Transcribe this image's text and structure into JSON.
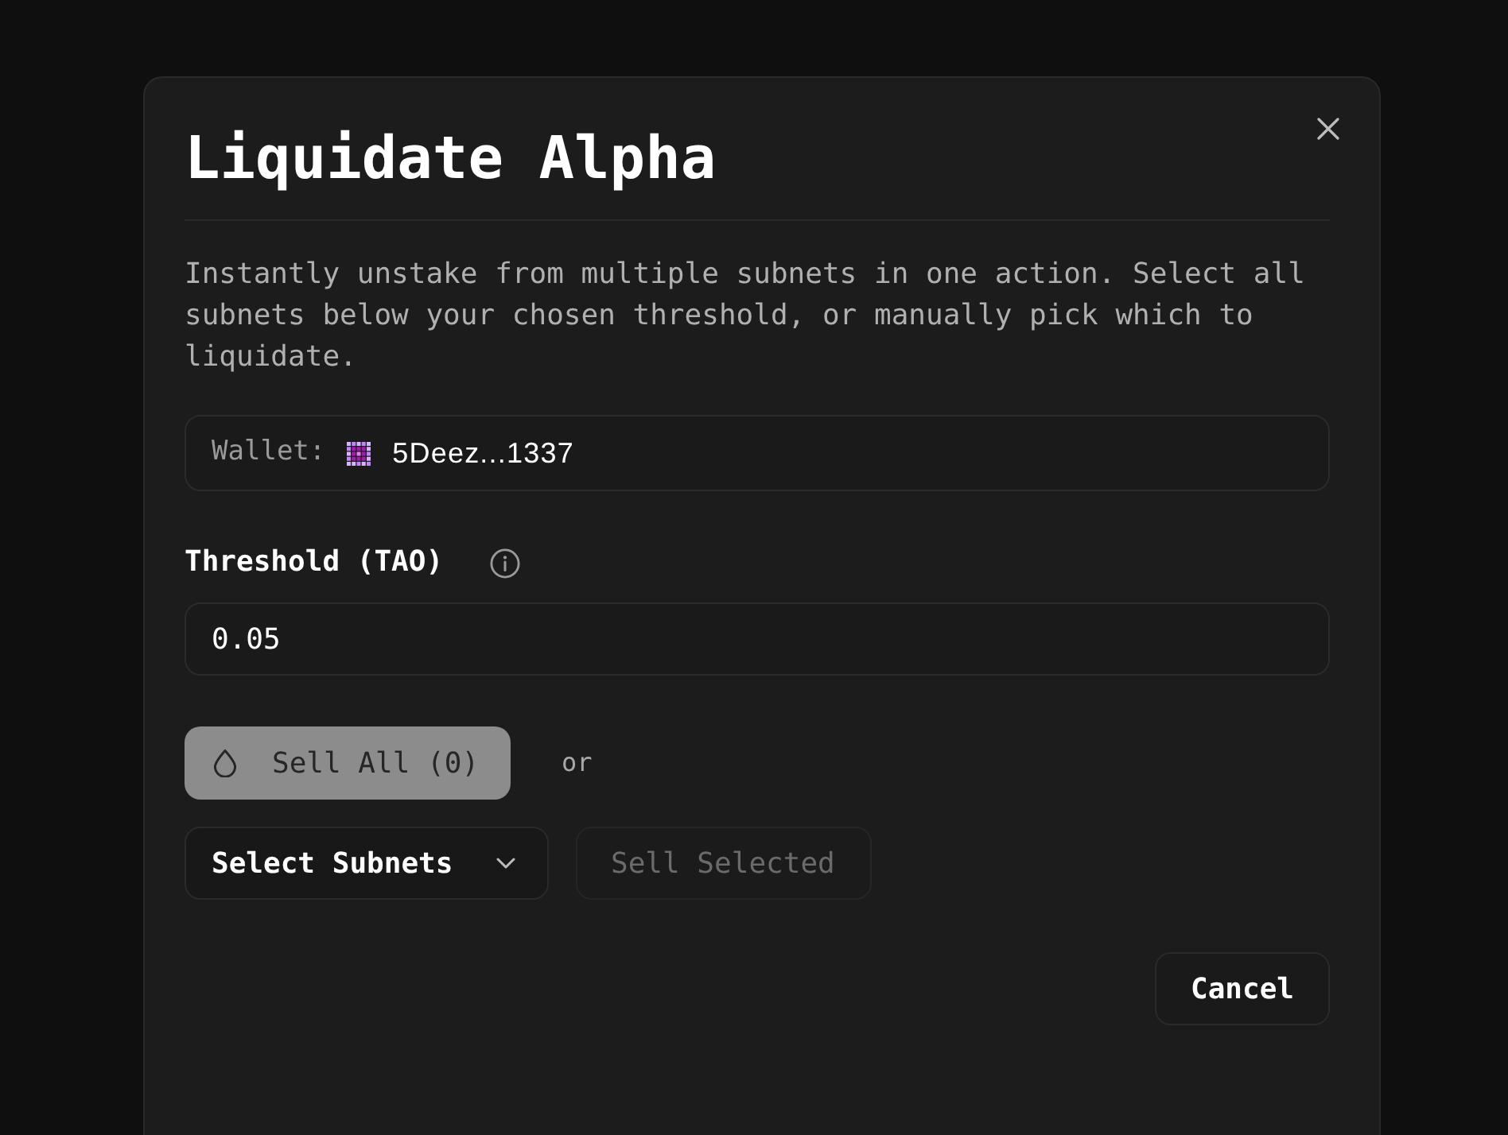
{
  "dialog": {
    "title": "Liquidate Alpha",
    "description": "Instantly unstake from multiple subnets in one action. Select all subnets below your chosen threshold, or manually pick which to liquidate."
  },
  "wallet": {
    "label": "Wallet:",
    "address": "5Deez...1337"
  },
  "threshold": {
    "label": "Threshold (TAO)",
    "value": "0.05"
  },
  "sell_all": {
    "label": "Sell All (0)",
    "disabled": true
  },
  "separator_text": "or",
  "subnet_select": {
    "label": "Select Subnets"
  },
  "sell_selected": {
    "label": "Sell Selected",
    "disabled": true
  },
  "footer": {
    "buttons": [
      {
        "label": "Cancel"
      }
    ]
  }
}
